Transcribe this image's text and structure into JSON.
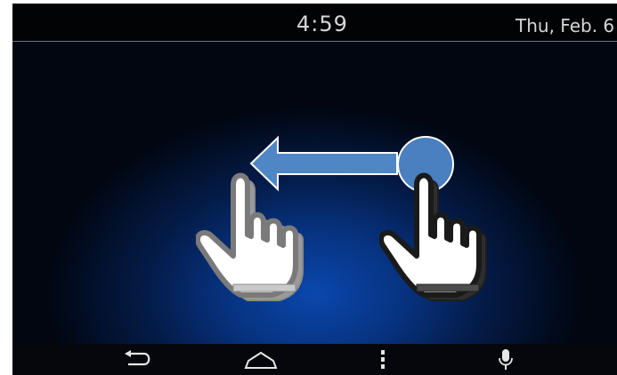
{
  "status_bar": {
    "time": "4:59",
    "date": "Thu, Feb. 6"
  },
  "gesture_illustration": {
    "gesture": "swipe-left",
    "icons": [
      "hand-pointer-icon",
      "arrow-left-icon",
      "touch-point-icon",
      "hand-pointer-icon"
    ]
  },
  "nav_bar": {
    "buttons": [
      "back-icon",
      "home-icon",
      "menu-icon",
      "microphone-icon"
    ]
  },
  "colors": {
    "background_center": "#0a47ad",
    "background_edge": "#010611",
    "arrow_fill": "#4f87c6",
    "touch_point": "#4a7fc0",
    "status_text": "#d6d6d6"
  }
}
